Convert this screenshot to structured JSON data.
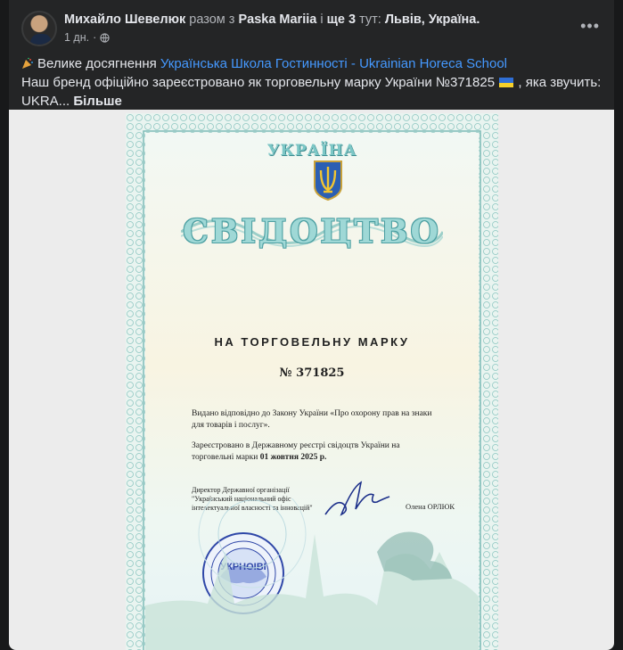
{
  "post": {
    "author": "Михайло Шевелюк",
    "with_prefix": "разом з",
    "tagged": "Paska Mariia",
    "and_more_prefix": "і",
    "and_more": "ще 3",
    "location_prefix": "тут:",
    "location": "Львів, Україна.",
    "time": "1 дн.",
    "privacy_icon": "globe-icon",
    "menu_icon": "more-options-icon",
    "text_line1_prefix": "Велике досягнення",
    "text_line1_link": "Українська Школа Гостинності - Ukrainian Horeca School",
    "text_line2": "Наш бренд офіційно зареєстровано як торговельну марку України №371825",
    "text_line2_suffix": ", яка звучить:",
    "text_line3": "UKRA...",
    "see_more": "Більше"
  },
  "certificate": {
    "country": "УКРАЇНА",
    "title": "СВІДОЦТВО",
    "subtitle": "НА ТОРГОВЕЛЬНУ МАРКУ",
    "number": "№ 371825",
    "para1": "Видано відповідно до Закону України «Про охорону прав на знаки для товарів і послуг».",
    "para2_prefix": "Зареєстровано в Державному реєстрі свідоцтв України на торговельні марки",
    "date": "01 жовтня 2025 р.",
    "director": "Директор Державної організації \"Український національний офіс інтелектуальної власності та інновацій\"",
    "signer": "Олена ОРЛЮК",
    "seal_text": "УКРНОІВІ"
  },
  "colors": {
    "background": "#18191a",
    "card": "#242526",
    "link": "#4599ff",
    "muted": "#b0b3b8"
  }
}
